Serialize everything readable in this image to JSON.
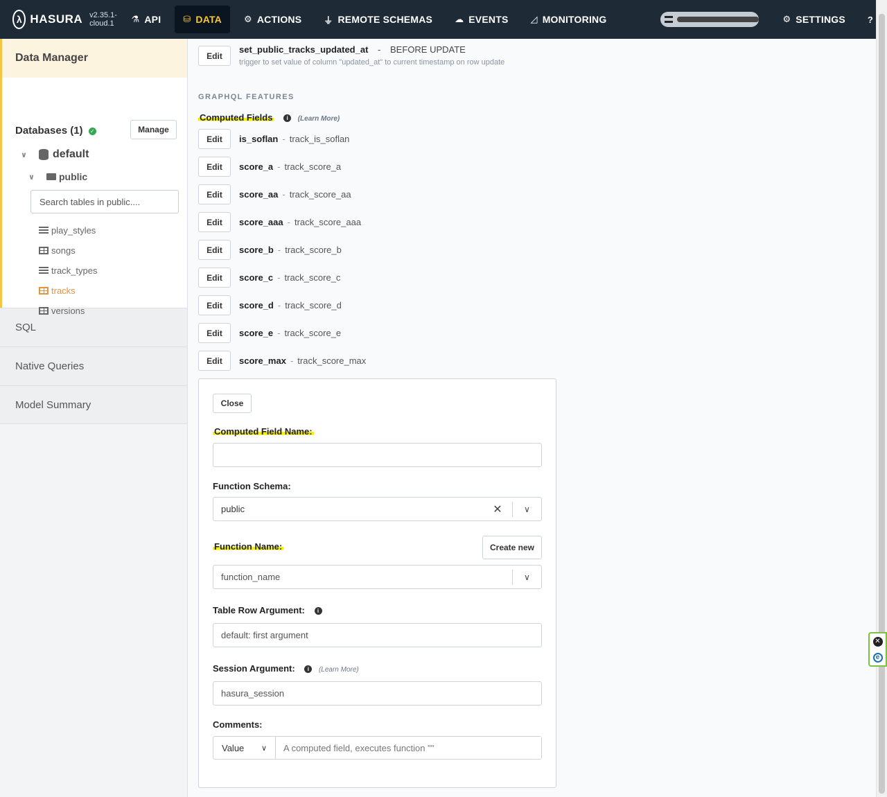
{
  "brand": {
    "name": "HASURA",
    "version": "v2.35.1-cloud.1"
  },
  "nav": [
    {
      "label": "API",
      "icon": "flask-icon",
      "glyph": "⚗"
    },
    {
      "label": "DATA",
      "icon": "database-icon",
      "glyph": "⛁",
      "active": true
    },
    {
      "label": "ACTIONS",
      "icon": "cogs-icon",
      "glyph": "⚙"
    },
    {
      "label": "REMOTE SCHEMAS",
      "icon": "plug-icon",
      "glyph": "⏚"
    },
    {
      "label": "EVENTS",
      "icon": "cloud-icon",
      "glyph": "☁"
    },
    {
      "label": "MONITORING",
      "icon": "chart-icon",
      "glyph": "◿"
    },
    {
      "label": "SETTINGS",
      "icon": "gear-icon",
      "glyph": "⚙"
    },
    {
      "label": "HEL",
      "icon": "help-icon",
      "glyph": "?"
    }
  ],
  "sidebar": {
    "header": "Data Manager",
    "databases_label": "Databases (1)",
    "manage": "Manage",
    "db_name": "default",
    "schema": "public",
    "search_placeholder": "Search tables in public....",
    "tables": [
      {
        "name": "play_styles",
        "type": "list"
      },
      {
        "name": "songs",
        "type": "table"
      },
      {
        "name": "track_types",
        "type": "list"
      },
      {
        "name": "tracks",
        "type": "table",
        "active": true
      },
      {
        "name": "versions",
        "type": "table"
      }
    ],
    "sections": [
      "SQL",
      "Native Queries",
      "Model Summary"
    ]
  },
  "trigger": {
    "edit": "Edit",
    "name": "set_public_tracks_updated_at",
    "separator": "-",
    "when": "BEFORE UPDATE",
    "description": "trigger to set value of column \"updated_at\" to current timestamp on row update"
  },
  "graphql_features_label": "GRAPHQL FEATURES",
  "computed_fields_title": "Computed Fields",
  "learn_more": "(Learn More)",
  "edit_label": "Edit",
  "computed_fields": [
    {
      "name": "is_soflan",
      "function": "track_is_soflan"
    },
    {
      "name": "score_a",
      "function": "track_score_a"
    },
    {
      "name": "score_aa",
      "function": "track_score_aa"
    },
    {
      "name": "score_aaa",
      "function": "track_score_aaa"
    },
    {
      "name": "score_b",
      "function": "track_score_b"
    },
    {
      "name": "score_c",
      "function": "track_score_c"
    },
    {
      "name": "score_d",
      "function": "track_score_d"
    },
    {
      "name": "score_e",
      "function": "track_score_e"
    },
    {
      "name": "score_max",
      "function": "track_score_max"
    }
  ],
  "form": {
    "close": "Close",
    "cf_name_label": "Computed Field Name:",
    "cf_name_value": "",
    "schema_label": "Function Schema:",
    "schema_value": "public",
    "fn_name_label": "Function Name:",
    "create_new": "Create new",
    "fn_name_placeholder": "function_name",
    "table_row_label": "Table Row Argument:",
    "table_row_placeholder": "default: first argument",
    "session_label": "Session Argument:",
    "session_learn": "(Learn More)",
    "session_placeholder": "hasura_session",
    "comments_label": "Comments:",
    "comment_type": "Value",
    "comment_placeholder": "A computed field, executes function \"\""
  },
  "highlight_color": "#f4f000",
  "accent_color": "#f8c832"
}
